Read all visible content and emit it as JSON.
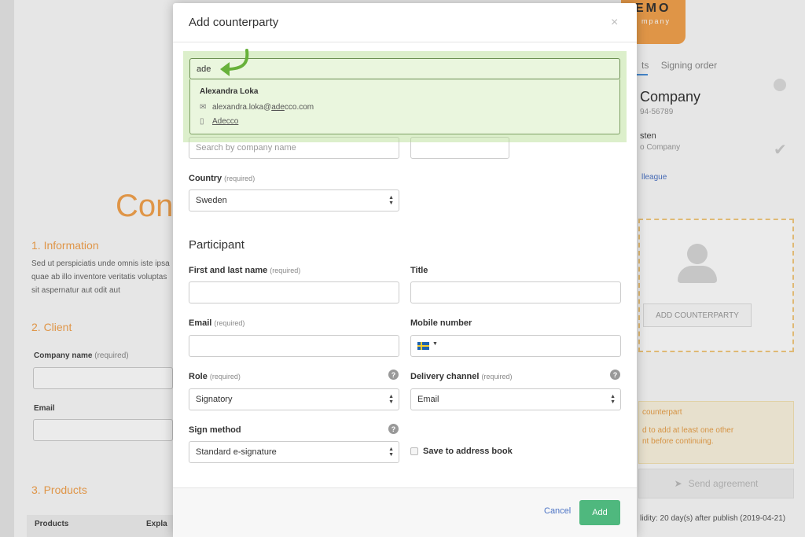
{
  "background": {
    "doc_title_partial": "Con",
    "sections": {
      "information": "1. Information",
      "client": "2. Client",
      "products": "3. Products"
    },
    "lorem": "Sed ut perspiciatis unde omnis iste ipsa quae ab illo inventore veritatis voluptas sit aspernatur aut odit aut",
    "company_name_label": "Company name",
    "required": "(required)",
    "email_label": "Email",
    "products_table": {
      "col1": "Products",
      "col2": "Expla"
    },
    "logo": {
      "line1": "EMO",
      "line2": "mpany"
    },
    "tabs": {
      "partial": "ts",
      "signing_order": "Signing order"
    },
    "company_heading_partial": "Company",
    "company_phone_partial": "94-56789",
    "signer_name_partial": "sten",
    "signer_company_partial": "o Company",
    "colleague_link_partial": "lleague",
    "add_counterparty_button": "ADD COUNTERPARTY",
    "warning_title_partial": "counterpart",
    "warning_text_partial_1": "d to add at least one other",
    "warning_text_partial_2": "nt before continuing.",
    "send_button": "Send agreement",
    "validity": "lidity: 20 day(s) after publish (2019-04-21)"
  },
  "modal": {
    "title": "Add counterparty",
    "close_glyph": "×",
    "search": {
      "value": "ade",
      "result": {
        "name": "Alexandra Loka",
        "email_pre": "alexandra.loka@",
        "email_match": "ade",
        "email_post": "cco.com",
        "company_match": "Ade",
        "company_post": "cco"
      }
    },
    "company_placeholder": "Search by company name",
    "country_label": "Country",
    "required": "(required)",
    "country_value": "Sweden",
    "participant_heading": "Participant",
    "name_label": "First and last name",
    "title_label": "Title",
    "email_label": "Email",
    "mobile_label": "Mobile number",
    "role_label": "Role",
    "role_value": "Signatory",
    "delivery_label": "Delivery channel",
    "delivery_value": "Email",
    "sign_method_label": "Sign method",
    "sign_method_value": "Standard e-signature",
    "save_address_book": "Save to address book",
    "help_glyph": "?",
    "cancel": "Cancel",
    "add": "Add"
  },
  "colors": {
    "accent_orange": "#f2a24e",
    "highlight_green": "#b2db8c",
    "arrow_green": "#67b13a",
    "add_button": "#4fb87e",
    "link_blue": "#4a72c4"
  }
}
